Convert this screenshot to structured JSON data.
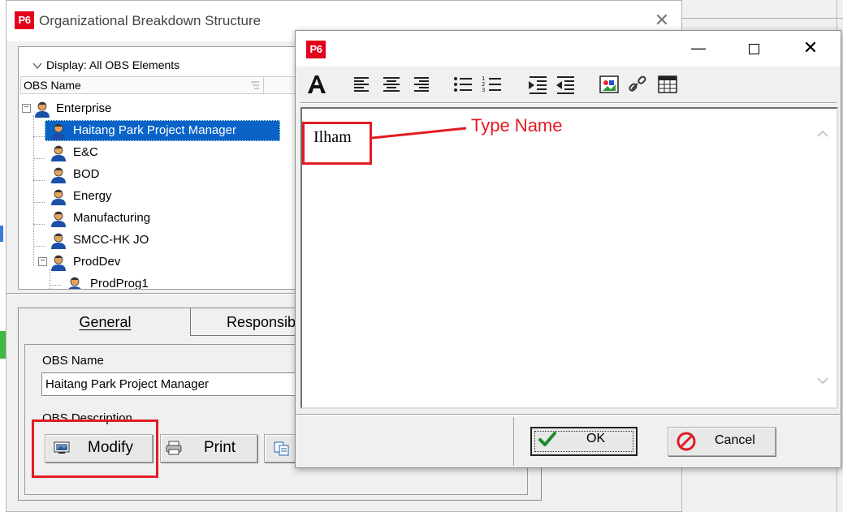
{
  "obs_window": {
    "logo": "P6",
    "title": "Organizational Breakdown Structure",
    "close_glyph": "✕"
  },
  "tree": {
    "display_label": "Display: All OBS Elements",
    "column_header": "OBS Name",
    "items": [
      {
        "label": "Enterprise",
        "level": 0,
        "expanded": true
      },
      {
        "label": "Haitang Park Project Manager",
        "level": 1,
        "selected": true
      },
      {
        "label": "E&C",
        "level": 1
      },
      {
        "label": "BOD",
        "level": 1
      },
      {
        "label": "Energy",
        "level": 1
      },
      {
        "label": "Manufacturing",
        "level": 1
      },
      {
        "label": "SMCC-HK JO",
        "level": 1
      },
      {
        "label": "ProdDev",
        "level": 1,
        "expanded": true
      },
      {
        "label": "ProdProg1",
        "level": 2
      }
    ]
  },
  "tabs": [
    {
      "label": "General",
      "active": true
    },
    {
      "label": "Responsibi",
      "active": false
    }
  ],
  "general": {
    "obs_name_label": "OBS Name",
    "obs_name_value": "Haitang Park Project Manager",
    "obs_description_label": "OBS Description",
    "buttons": {
      "modify": "Modify",
      "print": "Print"
    }
  },
  "notebook_dialog": {
    "logo": "P6",
    "minimize_glyph": "—",
    "close_glyph": "✕",
    "toolbar_icons": [
      "font-icon",
      "align-left-icon",
      "align-center-icon",
      "align-right-icon",
      "bullet-list-icon",
      "numbered-list-icon",
      "indent-icon",
      "outdent-icon",
      "insert-picture-icon",
      "insert-link-icon",
      "insert-table-icon"
    ],
    "editor_text": "Ilham",
    "buttons": {
      "ok": "OK",
      "cancel": "Cancel"
    }
  },
  "annotation": {
    "label": "Type Name",
    "color": "#e41b23"
  },
  "colors": {
    "selection": "#0a64c8",
    "p6_red": "#e4001b"
  }
}
